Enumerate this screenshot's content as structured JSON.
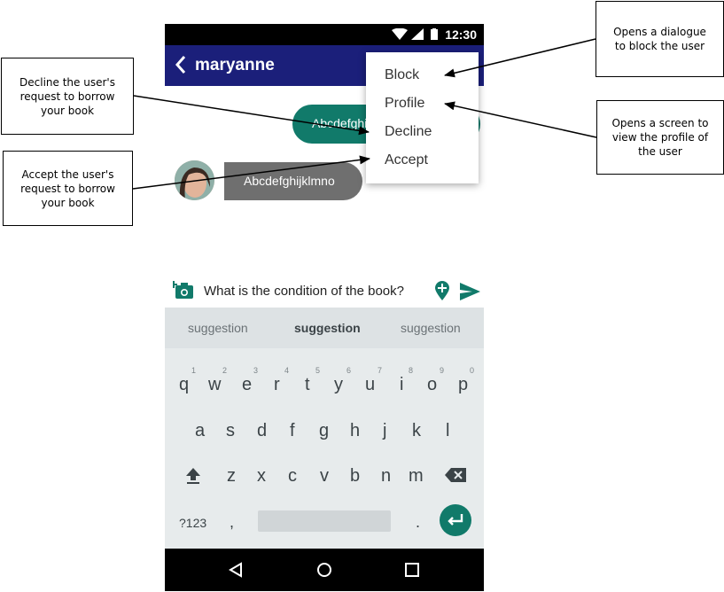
{
  "status_bar": {
    "time": "12:30"
  },
  "app_bar": {
    "title": "maryanne"
  },
  "messages": {
    "outgoing": "Abcdefghijklmno",
    "incoming": "Abcdefghijklmno"
  },
  "menu": {
    "items": [
      "Block",
      "Profile",
      "Decline",
      "Accept"
    ]
  },
  "annotations": {
    "block": "Opens a dialogue to block the user",
    "profile": "Opens a screen to view the profile of the user",
    "decline": "Decline the user's request to borrow your book",
    "accept": "Accept the user's request to borrow your book"
  },
  "compose": {
    "text": "What is the condition of the book?"
  },
  "keyboard": {
    "suggestions": [
      "suggestion",
      "suggestion",
      "suggestion"
    ],
    "row1": [
      "q",
      "w",
      "e",
      "r",
      "t",
      "y",
      "u",
      "i",
      "o",
      "p"
    ],
    "row1_numbers": [
      "1",
      "2",
      "3",
      "4",
      "5",
      "6",
      "7",
      "8",
      "9",
      "0"
    ],
    "row2": [
      "a",
      "s",
      "d",
      "f",
      "g",
      "h",
      "j",
      "k",
      "l"
    ],
    "row3": [
      "z",
      "x",
      "c",
      "v",
      "b",
      "n",
      "m"
    ],
    "symbols_key": "?123",
    "comma_key": ",",
    "period_key": "."
  },
  "colors": {
    "app_bar": "#1b1f7a",
    "accent": "#117a6a",
    "incoming_bubble": "#6f6f6f"
  }
}
